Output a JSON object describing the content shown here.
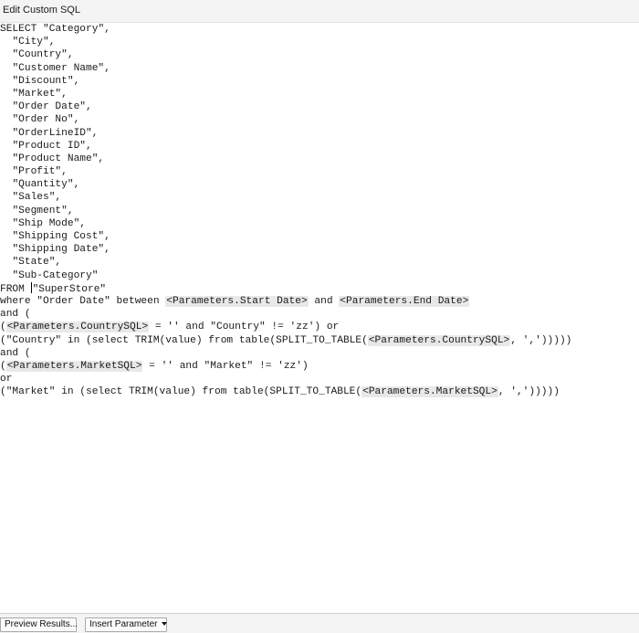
{
  "window": {
    "title": "Edit Custom SQL"
  },
  "editor": {
    "select_kw": "SELECT",
    "first_column": "\"Category\",",
    "columns": [
      "\"City\",",
      "\"Country\",",
      "\"Customer Name\",",
      "\"Discount\",",
      "\"Market\",",
      "\"Order Date\",",
      "\"Order No\",",
      "\"OrderLineID\",",
      "\"Product ID\",",
      "\"Product Name\",",
      "\"Profit\",",
      "\"Quantity\",",
      "\"Sales\",",
      "\"Segment\",",
      "\"Ship Mode\",",
      "\"Shipping Cost\",",
      "\"Shipping Date\",",
      "\"State\",",
      "\"Sub-Category\""
    ],
    "from_kw": "FROM",
    "from_table": "\"SuperStore\"",
    "where_prefix": "where \"Order Date\" between",
    "param_start_date": "<Parameters.Start Date>",
    "where_and": "and",
    "param_end_date": "<Parameters.End Date>",
    "and_open_1": "and (",
    "open_paren": "(",
    "param_country_sql": "<Parameters.CountrySQL>",
    "country_cond_rest": " = '' and \"Country\" != 'zz') or",
    "country_in_prefix": "(\"Country\" in (select TRIM(value) from table(SPLIT_TO_TABLE(",
    "country_in_suffix": ", ','))))) ",
    "and_open_2": "and (",
    "param_market_sql": "<Parameters.MarketSQL>",
    "market_cond_rest": " = '' and \"Market\" != 'zz')",
    "or_kw": "or",
    "market_in_prefix": "(\"Market\" in (select TRIM(value) from table(SPLIT_TO_TABLE(",
    "market_in_suffix": ", ',')))))"
  },
  "footer": {
    "preview_button": "Preview Results...",
    "insert_parameter_button": "Insert Parameter"
  }
}
